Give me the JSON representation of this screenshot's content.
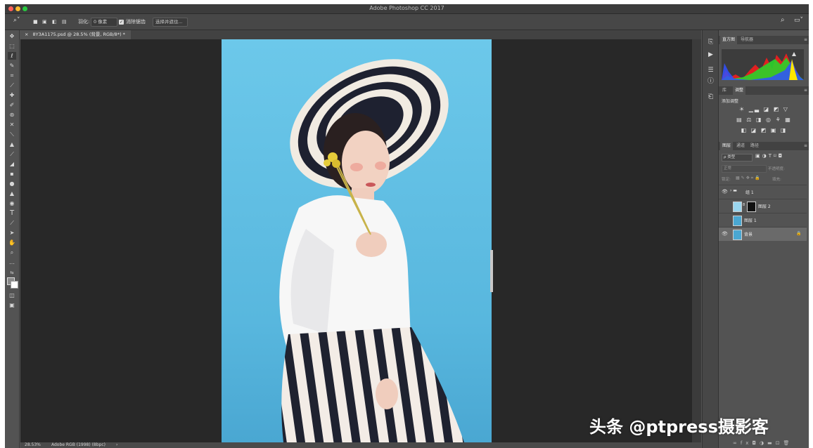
{
  "app": {
    "title": "Adobe Photoshop CC 2017"
  },
  "options": {
    "feather_label": "羽化:",
    "feather_value": "0 像素",
    "antialias_label": "消除锯齿",
    "select_mask_label": "选择并遮住..."
  },
  "document": {
    "tab_title": "8Y3A1175.psd @ 28.5% (背景, RGB/8*) *"
  },
  "status": {
    "zoom": "28.53%",
    "profile": "Adobe RGB (1998) (8bpc)",
    "arrow": "›"
  },
  "panels": {
    "top_tabs": [
      "直方图",
      "导航器"
    ],
    "mid_tabs": [
      "库",
      "调整"
    ],
    "adjustments_title": "添加调整",
    "layer_tabs": [
      "图层",
      "通道",
      "路径"
    ],
    "filter_kind": "ρ 类型",
    "blend_mode": "正常",
    "opacity_label": "不透明度:",
    "lock_label": "锁定:",
    "fill_label": "填充:",
    "layers": [
      {
        "name": "组 1",
        "visible": true,
        "kind": "group",
        "selected": false
      },
      {
        "name": "图层 2",
        "visible": false,
        "kind": "mask",
        "selected": false
      },
      {
        "name": "图层 1",
        "visible": false,
        "kind": "photo",
        "selected": false
      },
      {
        "name": "背景",
        "visible": true,
        "kind": "photo",
        "selected": true
      }
    ]
  },
  "watermark": "头条 @ptpress摄影客",
  "colors": {
    "bg_blue": "#62bfe3",
    "ui_dark": "#535353"
  }
}
